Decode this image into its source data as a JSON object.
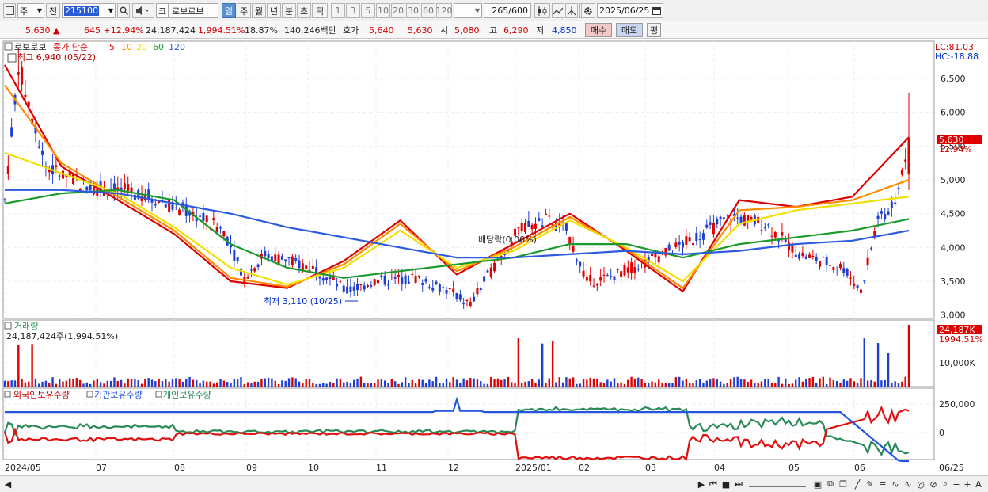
{
  "toolbar": {
    "market_type": "주",
    "prev_label": "전",
    "stock_code": "215100",
    "market_tag": "코",
    "stock_name": "로보로보",
    "periods": [
      "일",
      "주",
      "월",
      "년",
      "분",
      "초",
      "틱"
    ],
    "selected_period": "일",
    "intervals": [
      "1",
      "3",
      "5",
      "10",
      "20",
      "30",
      "60",
      "120"
    ],
    "count_value": "265",
    "count_total": "/600",
    "date": "2025/06/25"
  },
  "quote": {
    "price": "5,630",
    "change_arrow": "▲",
    "change": "645",
    "change_pct": "+12.94%",
    "volume": "24,187,424",
    "volume_ratio": "1,994.51%",
    "turnover": "18.87%",
    "amount": "140,246백만",
    "bid_label": "호가",
    "ask_price": "5,640",
    "bid_price": "5,630",
    "open_label": "시",
    "open": "5,080",
    "high_label": "고",
    "high": "6,290",
    "low_label": "저",
    "low": "4,850",
    "buy_label": "매수",
    "sell_label": "매도",
    "extra_label": "평"
  },
  "price_panel": {
    "name": "로보로보",
    "ma_title": "종가 단순",
    "ma_periods": [
      "5",
      "10",
      "20",
      "60",
      "120"
    ],
    "high_note": "최고 6,940 (05/22)",
    "low_note": "최저 3,110 (10/25)",
    "dividend_note": "배당락(0.00%)",
    "lc": "LC:81.03",
    "hc": "HC:-18.88",
    "y_ticks": [
      "6,500",
      "6,000",
      "5,500",
      "5,000",
      "4,500",
      "4,000",
      "3,500",
      "3,000"
    ],
    "current_price_tag": "5,630",
    "current_pct_tag": "12.94%"
  },
  "volume_panel": {
    "title": "거래량",
    "value_text": "24,187,424주(1,994.51%)",
    "tag": "24,187K",
    "tag_pct": "1994.51%",
    "y_tick": "10,000K"
  },
  "holding_panel": {
    "series": [
      "외국인보유수량",
      "기관보유수량",
      "개인보유수량"
    ],
    "y_ticks": [
      "250,000",
      "0"
    ]
  },
  "x_axis": [
    "2024/05",
    "07",
    "08",
    "09",
    "10",
    "11",
    "12",
    "2025/01",
    "02",
    "03",
    "04",
    "05",
    "06",
    "06/25"
  ],
  "colors": {
    "up": "#e00000",
    "down": "#1f3fd0",
    "ma5": "#e00000",
    "ma10": "#ff8c00",
    "ma20": "#f0e000",
    "ma60": "#1a9a2a",
    "ma120": "#2c5be0",
    "foreign": "#e01010",
    "institution": "#2255e0",
    "individual": "#2a8a55"
  },
  "chart_data": {
    "type": "line",
    "title": "로보로보",
    "ylim": [
      2950,
      7050
    ],
    "x": [
      "2024/05",
      "07",
      "08",
      "09",
      "10",
      "11",
      "12",
      "2025/01",
      "02",
      "03",
      "04",
      "05",
      "06",
      "06/25"
    ],
    "series": [
      {
        "name": "5",
        "values": [
          6700,
          5200,
          4700,
          4200,
          3500,
          3400,
          3800,
          4400,
          3600,
          4050,
          4500,
          3950,
          3350,
          4700,
          4600,
          4750,
          5630
        ]
      },
      {
        "name": "10",
        "values": [
          6400,
          5250,
          4750,
          4250,
          3550,
          3420,
          3750,
          4350,
          3650,
          4000,
          4450,
          3980,
          3400,
          4550,
          4600,
          4700,
          5000
        ]
      },
      {
        "name": "20",
        "values": [
          5400,
          5100,
          4800,
          4300,
          3700,
          3450,
          3700,
          4250,
          3700,
          3950,
          4400,
          4000,
          3500,
          4350,
          4550,
          4650,
          4750
        ]
      },
      {
        "name": "60",
        "values": [
          4650,
          4800,
          4850,
          4700,
          4050,
          3700,
          3550,
          3650,
          3750,
          3850,
          4050,
          4050,
          3850,
          4050,
          4150,
          4250,
          4420
        ]
      },
      {
        "name": "120",
        "values": [
          4850,
          4850,
          4800,
          4650,
          4500,
          4300,
          4150,
          4000,
          3850,
          3850,
          3900,
          3950,
          3900,
          3950,
          4050,
          4100,
          4250
        ]
      }
    ]
  }
}
